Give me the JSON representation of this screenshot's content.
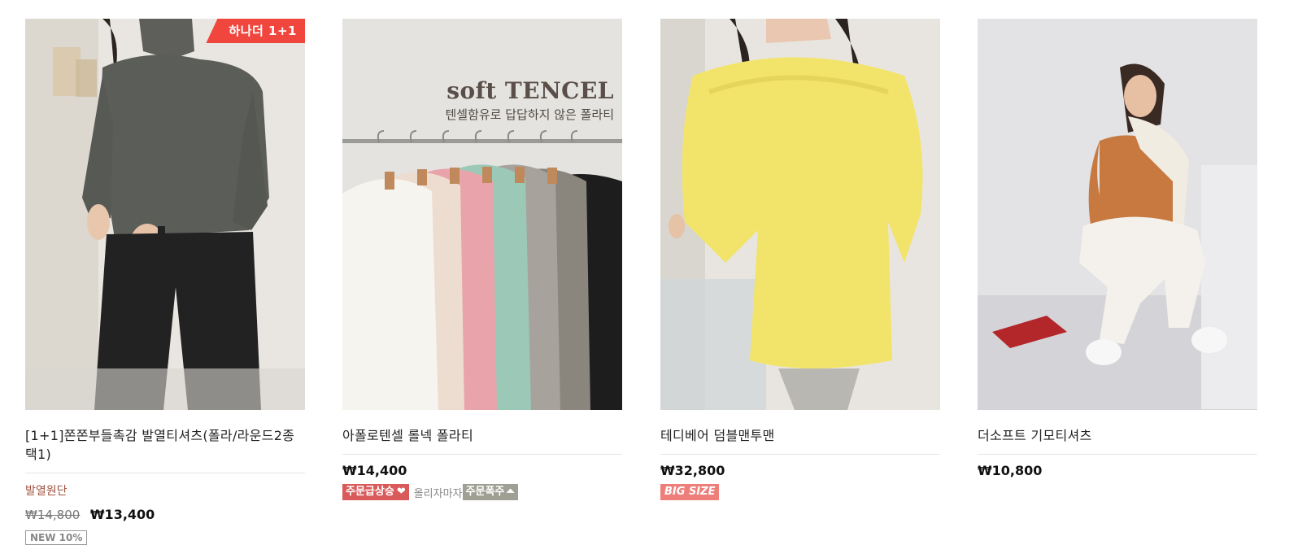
{
  "products": [
    {
      "corner_badge": "하나더 1+1",
      "title": "[1+1]쫀쫀부들촉감 발열티셔츠(폴라/라운드2종택1)",
      "subtitle": "발열원단",
      "original_price": "₩14,800",
      "price": "₩13,400",
      "tag": "NEW 10%"
    },
    {
      "overlay_title": "soft TENCEL",
      "overlay_subtitle": "텐셀함유로 답답하지 않은 폴라티",
      "title": "아폴로텐셀 롤넥 폴라티",
      "price": "₩14,400",
      "tags": {
        "hot_label": "주문급상승",
        "hot_icon": "heart-icon",
        "soon_label": "올리자마자",
        "rush_label": "주문폭주",
        "rush_icon": "up-arrow-icon"
      }
    },
    {
      "title": "테디베어 덤블맨투맨",
      "price": "₩32,800",
      "tag": "BIG SIZE"
    },
    {
      "title": "더소프트 기모티셔츠",
      "price": "₩10,800"
    }
  ],
  "colors": {
    "badge_red": "#f0463e",
    "subtitle_brown": "#a0523f",
    "tag_red": "#d95a5a",
    "tag_gray": "#9f9f93",
    "tag_bigsize": "#ee7e7a"
  }
}
